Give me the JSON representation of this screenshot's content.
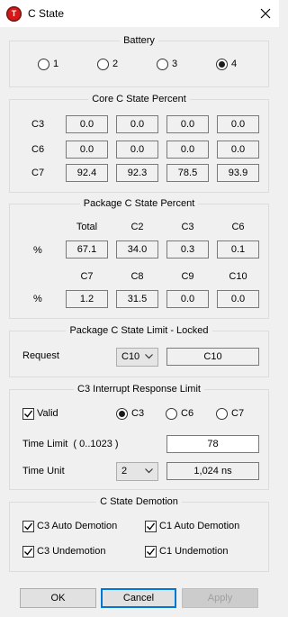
{
  "window": {
    "title": "C State",
    "app_icon": "t-logo-icon",
    "close_icon": "close-icon"
  },
  "battery": {
    "title": "Battery",
    "options": [
      "1",
      "2",
      "3",
      "4"
    ],
    "selected": "4"
  },
  "core": {
    "title": "Core C State Percent",
    "rows": [
      {
        "label": "C3",
        "values": [
          "0.0",
          "0.0",
          "0.0",
          "0.0"
        ]
      },
      {
        "label": "C6",
        "values": [
          "0.0",
          "0.0",
          "0.0",
          "0.0"
        ]
      },
      {
        "label": "C7",
        "values": [
          "92.4",
          "92.3",
          "78.5",
          "93.9"
        ]
      }
    ]
  },
  "package": {
    "title": "Package C State Percent",
    "row_label": "%",
    "headers1": [
      "Total",
      "C2",
      "C3",
      "C6"
    ],
    "values1": [
      "67.1",
      "34.0",
      "0.3",
      "0.1"
    ],
    "headers2": [
      "C7",
      "C8",
      "C9",
      "C10"
    ],
    "values2": [
      "1.2",
      "31.5",
      "0.0",
      "0.0"
    ]
  },
  "limit": {
    "title": "Package C State Limit - Locked",
    "request_label": "Request",
    "select_value": "C10",
    "result": "C10"
  },
  "interrupt": {
    "title": "C3 Interrupt Response Limit",
    "valid_label": "Valid",
    "valid_checked": true,
    "radio_options": [
      "C3",
      "C6",
      "C7"
    ],
    "radio_selected": "C3",
    "time_limit_label": "Time Limit  ( 0..1023 )",
    "time_limit_value": "78",
    "time_unit_label": "Time Unit",
    "time_unit_select": "2",
    "time_unit_value": "1,024 ns"
  },
  "demotion": {
    "title": "C State Demotion",
    "c3_auto": "C3 Auto Demotion",
    "c1_auto": "C1 Auto Demotion",
    "c3_undemotion": "C3 Undemotion",
    "c1_undemotion": "C1 Undemotion",
    "all_checked": true
  },
  "buttons": {
    "ok": "OK",
    "cancel": "Cancel",
    "apply": "Apply"
  },
  "colors": {
    "accent": "#0078d7",
    "app_icon": "#d21a1a",
    "background": "#f0f0f0"
  }
}
